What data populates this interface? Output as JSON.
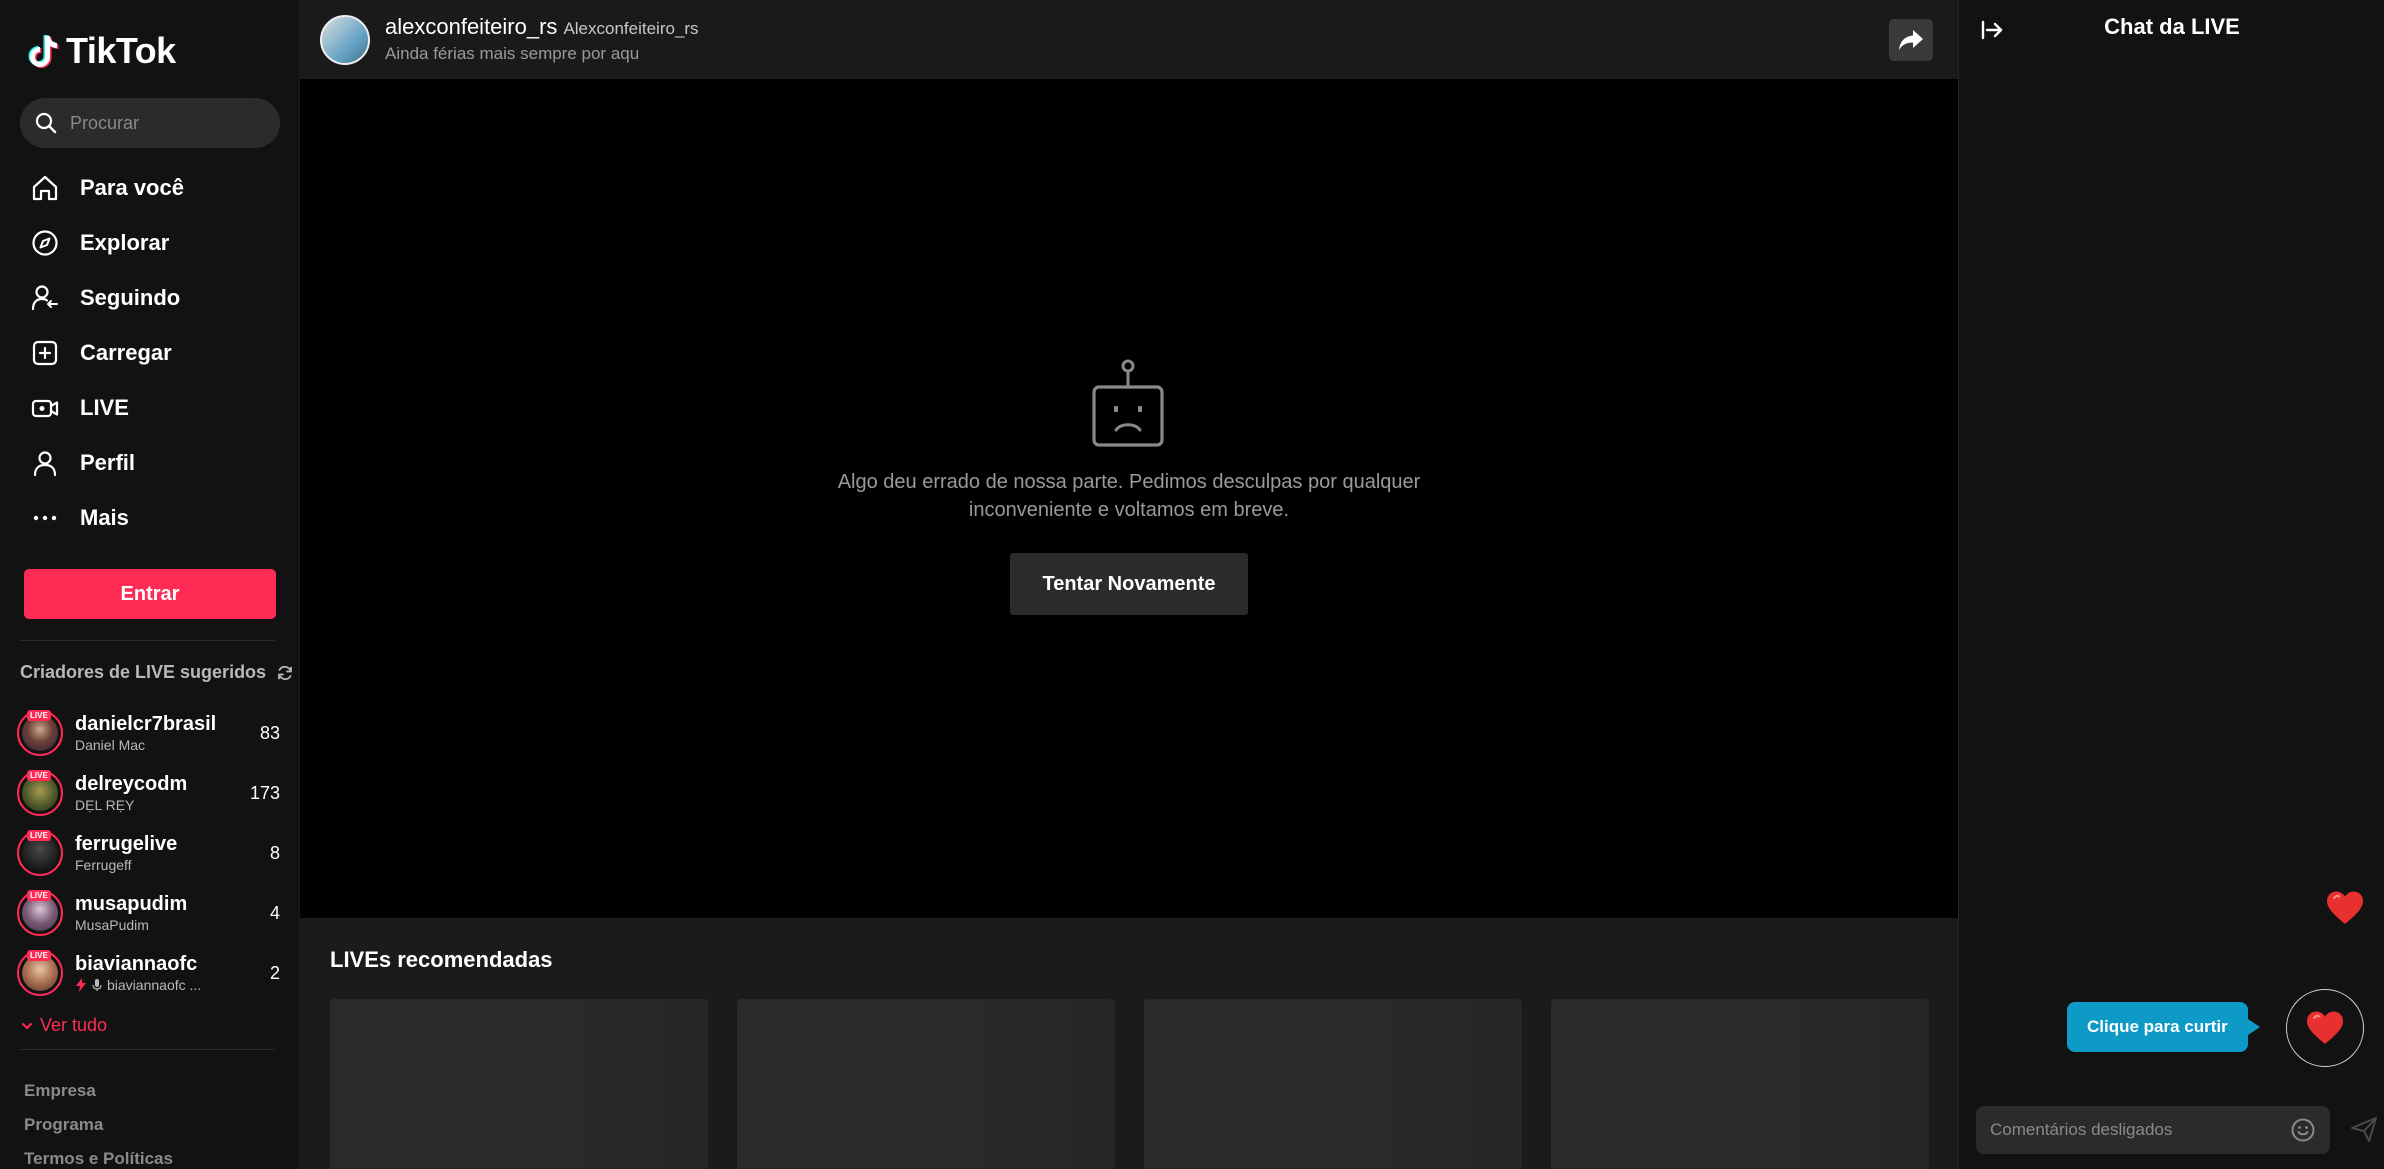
{
  "app": {
    "logo_text": "TikTok"
  },
  "search": {
    "placeholder": "Procurar"
  },
  "nav": {
    "items": [
      {
        "label": "Para você",
        "icon": "home-icon"
      },
      {
        "label": "Explorar",
        "icon": "compass-icon"
      },
      {
        "label": "Seguindo",
        "icon": "following-icon"
      },
      {
        "label": "Carregar",
        "icon": "upload-icon"
      },
      {
        "label": "LIVE",
        "icon": "live-camera-icon"
      },
      {
        "label": "Perfil",
        "icon": "profile-icon"
      },
      {
        "label": "Mais",
        "icon": "more-dots-icon"
      }
    ]
  },
  "login": {
    "label": "Entrar"
  },
  "creators": {
    "title": "Criadores de LIVE sugeridos",
    "live_badge": "LIVE",
    "items": [
      {
        "username": "danielcr7brasil",
        "display_name": "Daniel Mac",
        "viewers": "83"
      },
      {
        "username": "delreycodm",
        "display_name": "DẸL RẸY",
        "viewers": "173"
      },
      {
        "username": "ferrugelive",
        "display_name": "Ferrugeff",
        "viewers": "8"
      },
      {
        "username": "musapudim",
        "display_name": "MusaPudim",
        "viewers": "4"
      },
      {
        "username": "biaviannaofc",
        "display_name": "biaviannaofc ...",
        "viewers": "2"
      }
    ],
    "see_all": "Ver tudo"
  },
  "footer": {
    "links": [
      "Empresa",
      "Programa",
      "Termos e Políticas"
    ]
  },
  "host": {
    "username": "alexconfeiteiro_rs",
    "display_name": "Alexconfeiteiro_rs",
    "description": "Ainda férias mais sempre por aqu"
  },
  "error": {
    "message": "Algo deu errado de nossa parte. Pedimos desculpas por qualquer inconveniente e voltamos em breve.",
    "retry_label": "Tentar Novamente"
  },
  "recommended": {
    "title": "LIVEs recomendadas",
    "cards": 4
  },
  "chat": {
    "title": "Chat da LIVE",
    "like_tooltip": "Clique para curtir",
    "comment_placeholder": "Comentários desligados"
  },
  "colors": {
    "brand": "#fe2c55",
    "tooltip": "#0e9ac6",
    "heart": "#e8302e"
  }
}
